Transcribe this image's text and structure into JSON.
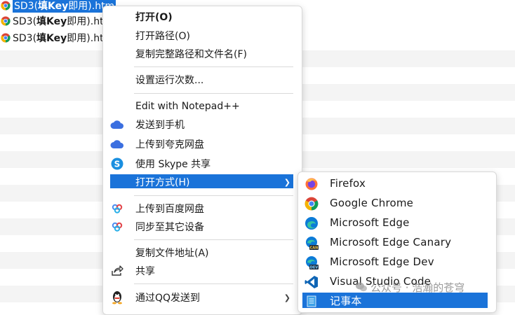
{
  "files": [
    {
      "name_prefix": "SD3(",
      "name_bold": "填Key",
      "name_suffix": "即用).htm",
      "selected": true
    },
    {
      "name_prefix": "SD3(",
      "name_bold": "填Key",
      "name_suffix": "即用).ht",
      "selected": false
    },
    {
      "name_prefix": "SD3(",
      "name_bold": "填Key",
      "name_suffix": "即用).ht",
      "selected": false
    }
  ],
  "menu": {
    "open": "打开(O)",
    "open_path": "打开路径(O)",
    "copy_full_path": "复制完整路径和文件名(F)",
    "set_run_count": "设置运行次数...",
    "edit_notepadpp": "Edit with Notepad++",
    "send_to_phone": "发送到手机",
    "upload_quark": "上传到夸克网盘",
    "share_skype": "使用 Skype 共享",
    "open_with": "打开方式(H)",
    "upload_baidu": "上传到百度网盘",
    "sync_devices": "同步至其它设备",
    "copy_file_address": "复制文件地址(A)",
    "share": "共享",
    "send_qq": "通过QQ发送到"
  },
  "submenu": {
    "firefox": "Firefox",
    "chrome": "Google Chrome",
    "edge": "Microsoft Edge",
    "edge_canary": "Microsoft Edge Canary",
    "edge_dev": "Microsoft Edge Dev",
    "vscode": "Visual Studio Code",
    "notepad": "记事本"
  },
  "watermark": {
    "text": "公众号 · 浩瀚的苍穹"
  },
  "colors": {
    "highlight": "#1a73d9",
    "stripe": "#f4f4f4"
  }
}
